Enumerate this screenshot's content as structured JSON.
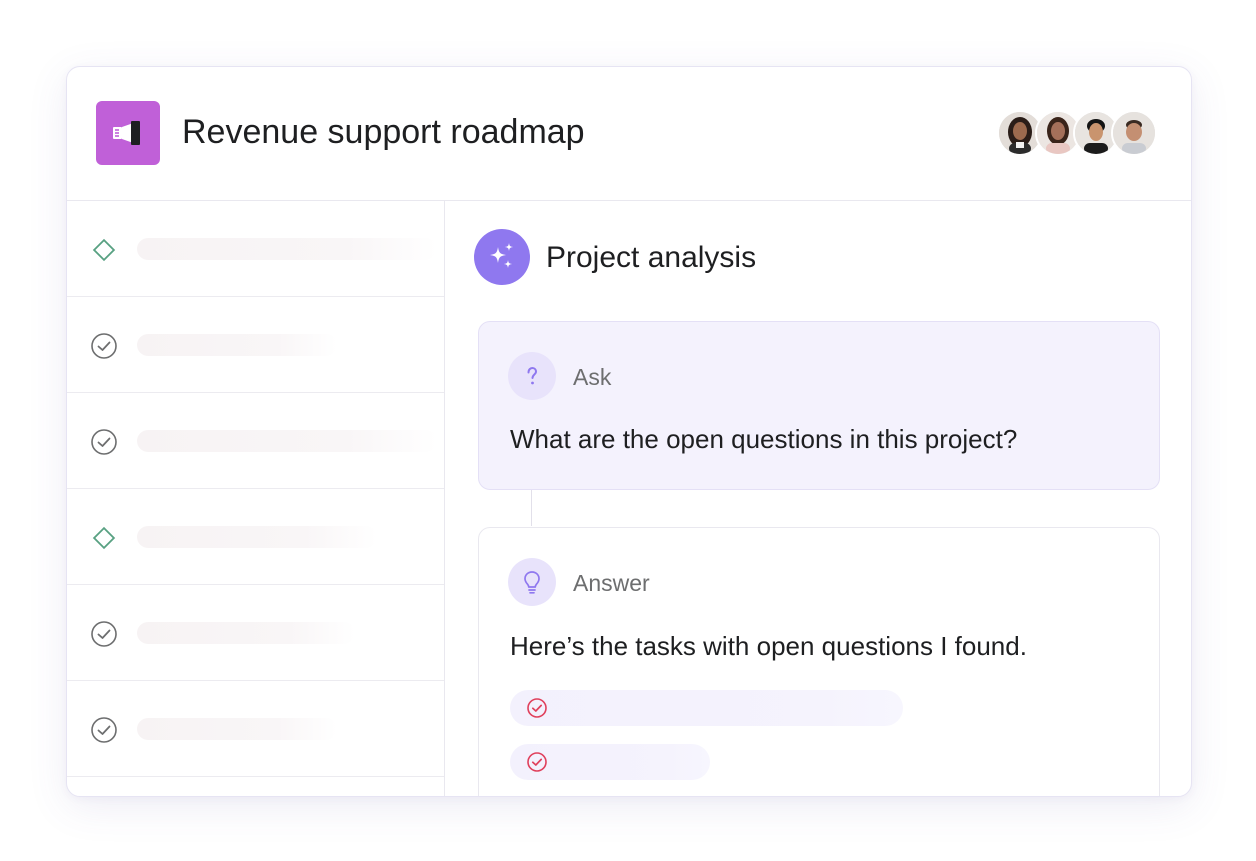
{
  "header": {
    "title": "Revenue support roadmap",
    "project_icon": "megaphone-icon",
    "project_icon_color": "#c060d8",
    "avatars": [
      "avatar-1",
      "avatar-2",
      "avatar-3",
      "avatar-4"
    ]
  },
  "task_list": {
    "rows": [
      {
        "icon": "milestone-diamond-icon"
      },
      {
        "icon": "check-circle-icon"
      },
      {
        "icon": "check-circle-icon"
      },
      {
        "icon": "milestone-diamond-icon"
      },
      {
        "icon": "check-circle-icon"
      },
      {
        "icon": "check-circle-icon"
      }
    ]
  },
  "analysis": {
    "title": "Project analysis",
    "icon": "sparkle-icon",
    "icon_color": "#8f78ef",
    "ask": {
      "label": "Ask",
      "icon": "question-mark-icon",
      "text": "What are the open questions in this project?"
    },
    "answer": {
      "label": "Answer",
      "icon": "lightbulb-icon",
      "text": "Here’s the tasks with open questions I found.",
      "results": [
        {
          "icon": "check-circle-icon",
          "color": "#e0405c"
        },
        {
          "icon": "check-circle-icon",
          "color": "#e0405c"
        }
      ]
    }
  },
  "colors": {
    "milestone": "#58a182",
    "check": "#6d6e6f",
    "accent_purple": "#8f78ef",
    "ask_background": "#f4f2fd"
  }
}
